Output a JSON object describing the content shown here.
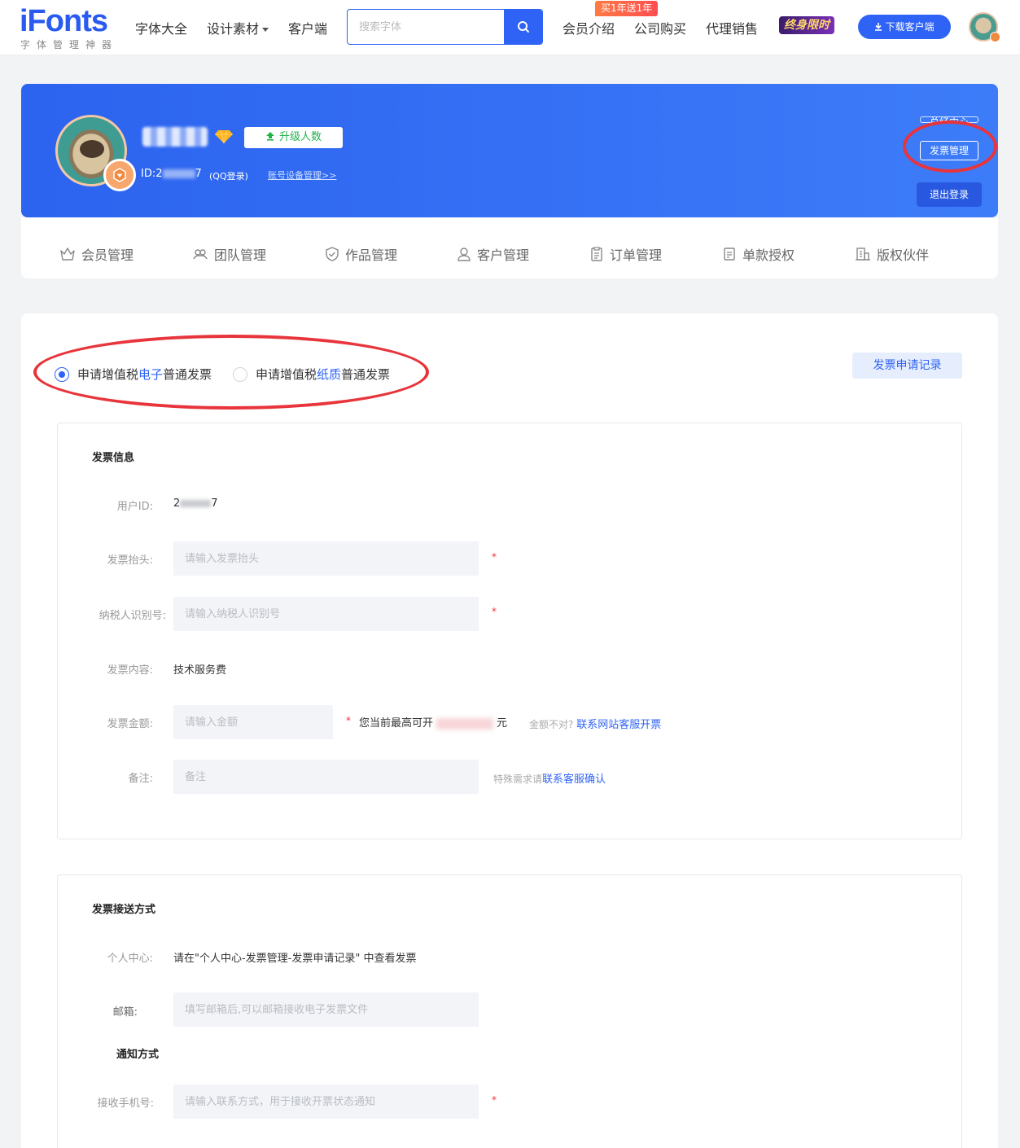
{
  "header": {
    "logo": "iFonts",
    "logo_sub": "字体管理神器",
    "nav": [
      "字体大全",
      "设计素材",
      "客户端"
    ],
    "search_placeholder": "搜索字体",
    "promo_tag": "买1年送1年",
    "nav_right": [
      "会员介绍",
      "公司购买",
      "代理销售"
    ],
    "lifetime_badge": "终身限时",
    "download_label": "下载客户端"
  },
  "profile": {
    "upgrade_label": "升级人数",
    "id_prefix": "ID:2",
    "id_suffix": "7",
    "login_type": "(QQ登录)",
    "account_link": "账号设备管理>>",
    "side_sales": "总经中心",
    "side_invoice": "发票管理",
    "side_logout": "退出登录"
  },
  "tabs": [
    "会员管理",
    "团队管理",
    "作品管理",
    "客户管理",
    "订单管理",
    "单款授权",
    "版权伙伴"
  ],
  "invoice": {
    "radio_electronic_pre": "申请增值税",
    "radio_electronic_key": "电子",
    "radio_electronic_post": "普通发票",
    "radio_paper_pre": "申请增值税",
    "radio_paper_key": "纸质",
    "radio_paper_post": "普通发票",
    "record_button": "发票申请记录",
    "info_title": "发票信息",
    "user_id_label": "用户ID:",
    "user_id_prefix": "2",
    "user_id_suffix": "7",
    "title_label": "发票抬头:",
    "title_placeholder": "请输入发票抬头",
    "tax_label": "纳税人识别号:",
    "tax_placeholder": "请输入纳税人识别号",
    "content_label": "发票内容:",
    "content_value": "技术服务费",
    "amount_label": "发票金额:",
    "amount_placeholder": "请输入金额",
    "amount_note_pre": "您当前最高可开",
    "amount_note_post": "元",
    "amount_wrong": "金额不对?",
    "amount_contact": "联系网站客服开票",
    "remark_label": "备注:",
    "remark_placeholder": "备注",
    "remark_hint": "特殊需求请",
    "remark_contact": "联系客服确认",
    "required_mark": "*"
  },
  "delivery": {
    "title": "发票接送方式",
    "center_label": "个人中心:",
    "center_value": "请在\"个人中心-发票管理-发票申请记录\" 中查看发票",
    "email_label": "邮箱:",
    "email_placeholder": "填写邮箱后,可以邮箱接收电子发票文件",
    "notify_title": "通知方式",
    "phone_label": "接收手机号:",
    "phone_placeholder": "请输入联系方式，用于接收开票状态通知"
  },
  "colors": {
    "primary": "#2f63f5",
    "highlight_ring": "#e8343b",
    "upgrade_green": "#22b24c"
  }
}
